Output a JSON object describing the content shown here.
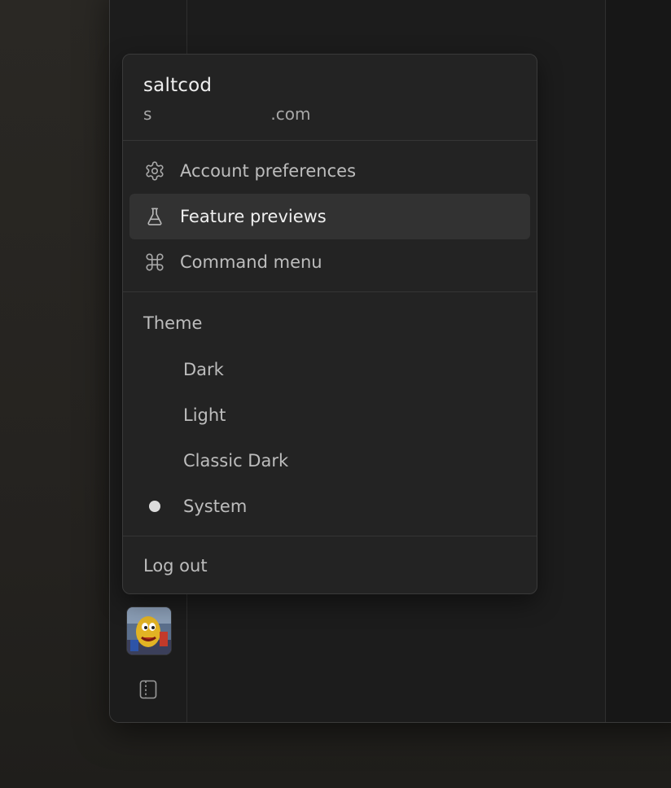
{
  "account": {
    "username": "saltcod",
    "email_prefix": "s",
    "email_suffix": ".com"
  },
  "menu": {
    "items": [
      {
        "label": "Account preferences",
        "icon": "gear-icon"
      },
      {
        "label": "Feature previews",
        "icon": "flask-icon"
      },
      {
        "label": "Command menu",
        "icon": "command-icon"
      }
    ],
    "active_item": "Feature previews"
  },
  "theme": {
    "heading": "Theme",
    "options": [
      "Dark",
      "Light",
      "Classic Dark",
      "System"
    ],
    "selected": "System"
  },
  "logout_label": "Log out",
  "colors": {
    "menu_bg": "#232323",
    "active_bg": "#323232",
    "text_primary": "#f0f0f0",
    "text_secondary": "#bdbdbd"
  },
  "icons": {
    "avatar": "avatar-image",
    "sidebar_toggle": "sidebar-toggle-icon"
  }
}
